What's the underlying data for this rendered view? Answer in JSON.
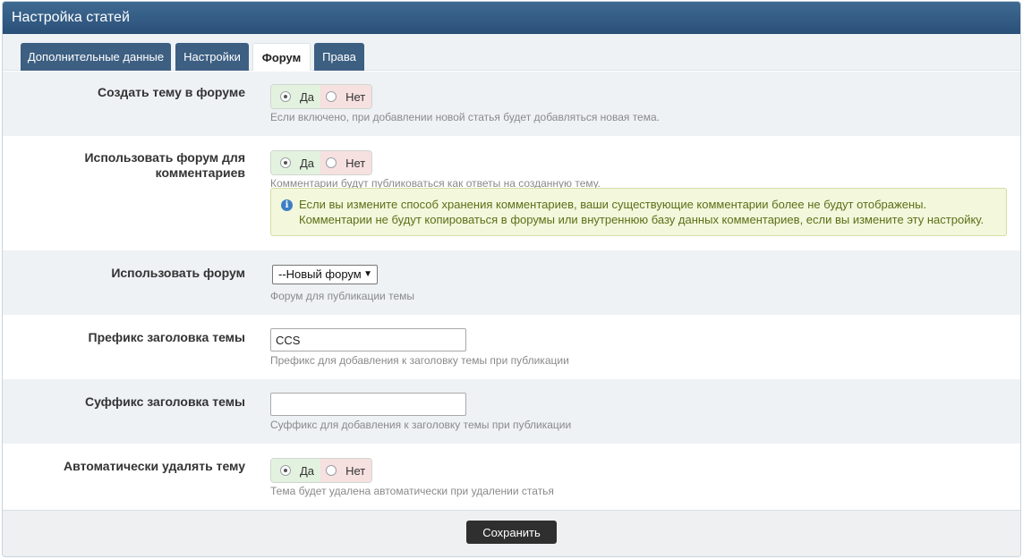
{
  "panel": {
    "title": "Настройка статей"
  },
  "tabs": [
    {
      "label": "Дополнительные данные",
      "active": false
    },
    {
      "label": "Настройки",
      "active": false
    },
    {
      "label": "Форум",
      "active": true
    },
    {
      "label": "Права",
      "active": false
    }
  ],
  "fields": {
    "create_topic": {
      "label": "Создать тему в форуме",
      "yes": "Да",
      "no": "Нет",
      "selected": "Да",
      "help": "Если включено, при добавлении новой статья будет добавляться новая тема."
    },
    "use_forum_comments": {
      "label_line1": "Использовать форум для",
      "label_line2": "комментариев",
      "yes": "Да",
      "no": "Нет",
      "selected": "Да",
      "help": "Комментарии будут публиковаться как ответы на созданную тему.",
      "notice_icon": "info-icon",
      "notice_line1": "Если вы измените способ хранения комментариев, ваши существующие комментарии более не будут отображены.",
      "notice_line2": "Комментарии не будут копироваться в форумы или внутреннюю базу данных комментариев, если вы измените эту настройку."
    },
    "use_forum": {
      "label": "Использовать форум",
      "selected": "--Новый форум",
      "help": "Форум для публикации темы"
    },
    "topic_prefix": {
      "label": "Префикс заголовка темы",
      "value": "CCS",
      "help": "Префикс для добавления к заголовку темы при публикации"
    },
    "topic_suffix": {
      "label": "Суффикс заголовка темы",
      "value": "",
      "help": "Суффикс для добавления к заголовку темы при публикации"
    },
    "auto_delete": {
      "label": "Автоматически удалять тему",
      "yes": "Да",
      "no": "Нет",
      "selected": "Да",
      "help": "Тема будет удалена автоматически при удалении статья"
    }
  },
  "footer": {
    "save_label": "Сохранить"
  },
  "colors": {
    "header": "#2f5a83",
    "tab": "#3c5f82",
    "yes_bg": "#e3f2df",
    "no_bg": "#f6e0e0",
    "notice_bg": "#f3f7dc",
    "notice_text": "#5c6f17",
    "save_button": "#2f2f2f"
  }
}
